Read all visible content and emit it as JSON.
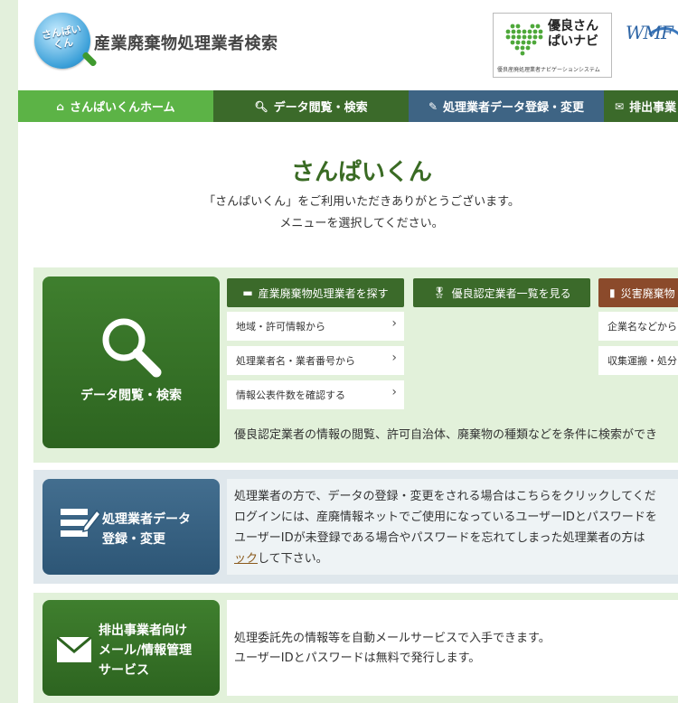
{
  "header": {
    "logo_text": "さんぱいくん",
    "site_title": "産業廃棄物処理業者検索",
    "partner_logo": {
      "title": "優良さんぱいナビ",
      "subtitle": "優良産廃処理業者ナビゲーションシステム"
    },
    "wmf_logo": "WMF"
  },
  "nav": {
    "items": [
      {
        "label": "さんぱいくんホーム",
        "icon": "home-icon",
        "color": "#5cb346"
      },
      {
        "label": "データ閲覧・検索",
        "icon": "search-icon",
        "color": "#3b6a2a"
      },
      {
        "label": "処理業者データ登録・変更",
        "icon": "edit-icon",
        "color": "#3e6484"
      },
      {
        "label": "排出事業",
        "icon": "mail-icon",
        "color": "#3b6a2a"
      }
    ]
  },
  "main": {
    "title": "さんぱいくん",
    "intro_line1": "「さんぱいくん」をご利用いただきありがとうございます。",
    "intro_line2": "メニューを選択してください。"
  },
  "section_search": {
    "big_button": "データ閲覧・検索",
    "categories": [
      {
        "label": "産業廃棄物処理業者を探す",
        "color": "#3b6a2a"
      },
      {
        "label": "優良認定業者一覧を見る",
        "color": "#3b6a2a"
      },
      {
        "label": "災害廃棄物",
        "color": "#8b4a2b"
      }
    ],
    "links_col1": [
      "地域・許可情報から",
      "処理業者名・業者番号から",
      "情報公表件数を確認する"
    ],
    "links_col3": [
      "企業名などから",
      "収集運搬・処分"
    ],
    "description": "優良認定業者の情報の閲覧、許可自治体、廃棄物の種類などを条件に検索ができ"
  },
  "section_register": {
    "big_button_line1": "処理業者データ",
    "big_button_line2": "登録・変更",
    "text_line1": "処理業者の方で、データの登録・変更をされる場合はこちらをクリックしてくだ",
    "text_line2": "ログインには、産廃情報ネットでご使用になっているユーザーIDとパスワードを",
    "text_line3": "ユーザーIDが未登録である場合やパスワードを忘れてしまった処理業者の方は",
    "text_line4_link": "ック",
    "text_line4_rest": "して下さい。"
  },
  "section_mail": {
    "big_button_line1": "排出事業者向け",
    "big_button_line2": "メール/情報管理",
    "big_button_line3": "サービス",
    "text_line1": "処理委託先の情報等を自動メールサービスで入手できます。",
    "text_line2": "ユーザーIDとパスワードは無料で発行します。"
  }
}
